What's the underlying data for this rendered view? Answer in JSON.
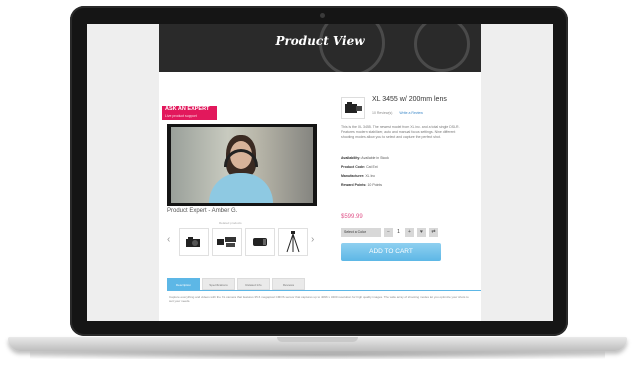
{
  "hero": {
    "title": "Product View"
  },
  "expert": {
    "badge_label": "ASK AN EXPERT",
    "badge_sub": "Live product support",
    "caption": "Product Expert - Amber G."
  },
  "gallery": {
    "label": "Related products",
    "thumbs": [
      "camera-icon",
      "lens-kit-icon",
      "lens-icon",
      "tripod-icon"
    ]
  },
  "product": {
    "title": "XL 3455 w/ 200mm lens",
    "reviews": "10 Review(s)",
    "write_review": "Write a Review",
    "description": "This is the XL 3455. The newest model from XL inc. and a total single DSLR. Features modern stabilizer, auto and manual focus settings. Nine different shooting modes allow you to select and capture the perfect shot.",
    "specs": [
      {
        "label": "Availability:",
        "value": "Available in Stock"
      },
      {
        "label": "Product Code:",
        "value": "Cat Ext"
      },
      {
        "label": "Manufacturer:",
        "value": "XL Inc"
      },
      {
        "label": "Reward Points:",
        "value": "10 Points"
      }
    ],
    "price": "$599.99",
    "color_select": "Select a Color",
    "quantity": "1",
    "add_to_cart": "ADD TO CART"
  },
  "tabs": [
    {
      "label": "Description",
      "active": true
    },
    {
      "label": "Specifications",
      "active": false
    },
    {
      "label": "Related Info",
      "active": false
    },
    {
      "label": "Reviews",
      "active": false
    }
  ],
  "tab_content": "Capture everything and videos with the XL camera that features 35.6 megapixel CMOS sensor that captures up to 4096 x 3400 resolution for high quality images. The wide array of shooting modes let you optimize your shots to suit your needs.",
  "colors": {
    "accent_blue": "#5db7e6",
    "accent_pink": "#e2185c",
    "price_pink": "#e0558a"
  }
}
